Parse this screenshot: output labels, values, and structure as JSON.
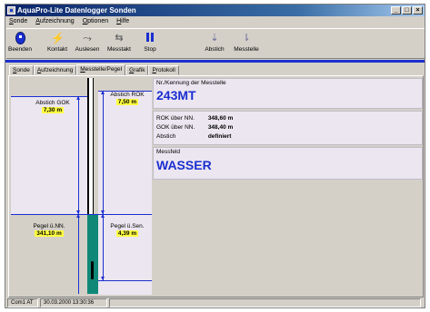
{
  "window": {
    "title": "AquaPro-Lite Datenlogger Sonden",
    "controls": [
      "_",
      "□",
      "×"
    ]
  },
  "menu": [
    "Sonde",
    "Aufzeichnung",
    "Optionen",
    "Hilfe"
  ],
  "toolbar": {
    "buttons": [
      {
        "label": "Beenden",
        "icon": "exit-icon"
      },
      {
        "label": "Kontakt",
        "icon": "probe-icon"
      },
      {
        "label": "Auslesen",
        "icon": "read-icon"
      },
      {
        "label": "Messtakt",
        "icon": "cycle-icon"
      },
      {
        "label": "Stop",
        "icon": "pause-icon"
      },
      {
        "label": "Abstich",
        "icon": "abstich-icon"
      },
      {
        "label": "Messtelle",
        "icon": "messtelle-icon"
      }
    ],
    "accent": "#1b2fd0"
  },
  "tabs": [
    "Sonde",
    "Aufzeichnung",
    "Messtelle/Pegel",
    "Grafik",
    "Protokoll"
  ],
  "active_tab": "Messtelle/Pegel",
  "drawing": {
    "abstich_rok_label": "Abstich ROK",
    "abstich_rok_value": "7,50 m",
    "abstich_gok_label": "Abstich GOK",
    "abstich_gok_value": "7,30 m",
    "pegel_nn_label": "Pegel ü.NN.",
    "pegel_nn_value": "341,10 m",
    "pegel_sen_label": "Pegel ü.Sen.",
    "pegel_sen_value": "4,39 m",
    "water_color": "#108878",
    "value_highlight": "#ffff40"
  },
  "info": {
    "kennung_caption": "Nr./Kennung der Messtelle",
    "kennung_value": "243MT",
    "rok_label": "ROK über NN.",
    "rok_value": "348,60 m",
    "gok_label": "GOK über NN.",
    "gok_value": "348,40 m",
    "abstich_label": "Abstich",
    "abstich_value": "definiert",
    "messfeld_caption": "Messfeld",
    "messfeld_value": "WASSER"
  },
  "status": [
    "Com1  AT",
    "30.03.2000  13:30:36",
    ""
  ]
}
